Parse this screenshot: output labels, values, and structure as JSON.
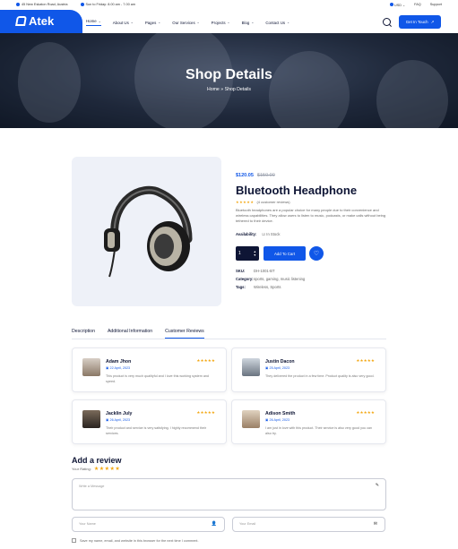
{
  "topbar": {
    "address": "45 New Eskaton Road, Austria",
    "hours": "Sun to Friday: 8.00 am - 7.00 am",
    "currency": "USD",
    "faq": "FAQ",
    "support": "Support"
  },
  "header": {
    "logo": "Atek",
    "nav": [
      {
        "label": "Home"
      },
      {
        "label": "About Us"
      },
      {
        "label": "Pages"
      },
      {
        "label": "Our Services"
      },
      {
        "label": "Projects"
      },
      {
        "label": "Blog"
      },
      {
        "label": "Contact Us"
      }
    ],
    "cta": "Get In Touch",
    "accent": "#1057e8"
  },
  "hero": {
    "title": "Shop Details",
    "crumb_home": "Home",
    "crumb_sep": "»",
    "crumb_current": "Shop Details"
  },
  "product": {
    "price": "$120.05",
    "old_price": "$150.00",
    "title": "Bluetooth Headphone",
    "stars": "★★★★★",
    "reviews_count": "(4 customer reviews)",
    "description": "Bluetooth headphones are a popular choice for many people due to their convenience and wireless capabilities. They allow users to listen to music, podcasts, or make calls without being tethered to their device.",
    "availability_label": "Availability:",
    "availability_value": "In Stock",
    "quantity": "1",
    "add_to_cart": "Add To Cart",
    "sku_label": "SKU:",
    "sku_value": "DH-1001-BT",
    "category_label": "Category:",
    "category_value": "sports, gaming, music listening",
    "tags_label": "Tags:",
    "tags_value": "Wireless, Sports"
  },
  "tabs": [
    "Description",
    "Additional Information",
    "Customer Reviews"
  ],
  "reviews": [
    {
      "name": "Adam Jhon",
      "date": "22 April, 2023",
      "stars": "★★★★★",
      "text": "This product is very much qualityful and I love this working system and speed."
    },
    {
      "name": "Justin Dacon",
      "date": "25 April, 2023",
      "stars": "★★★★★",
      "text": "They delivered the product in a few time. Product quality is also very good."
    },
    {
      "name": "Jacklin July",
      "date": "26 April, 2023",
      "stars": "★★★★★",
      "text": "Their product and service is very satisfying. I highly recommend their services."
    },
    {
      "name": "Adison Smith",
      "date": "26 April, 2023",
      "stars": "★★★★★",
      "text": "I am just in love with this product. Their service is also very good you can also try."
    }
  ],
  "review_form": {
    "title": "Add a review",
    "rating_label": "Your Rating:",
    "stars": "★★★★★",
    "message_placeholder": "Write a Message",
    "name_placeholder": "Your Name",
    "email_placeholder": "Your Email",
    "save_info": "Save my name, email, and website in this browser for the next time I comment."
  }
}
